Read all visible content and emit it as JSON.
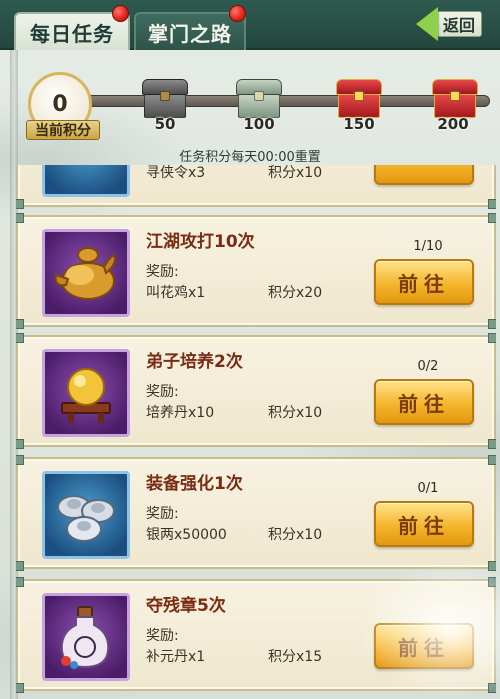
{
  "tabs": [
    {
      "label": "每日任务"
    },
    {
      "label": "掌门之路"
    }
  ],
  "back": {
    "label": "返回"
  },
  "progress": {
    "current_points": "0",
    "current_points_label": "当前积分",
    "milestones": [
      "50",
      "100",
      "150",
      "200"
    ],
    "reset_note": "任务积分每天00:00重置"
  },
  "tasks": [
    {
      "title": "江湖攻打10次",
      "reward_label": "奖励:",
      "reward_item": "叫花鸡x1",
      "reward_points": "积分x20",
      "progress": "1/10",
      "button": "前往",
      "icon": "roast-chicken-icon"
    },
    {
      "title": "弟子培养2次",
      "reward_label": "奖励:",
      "reward_item": "培养丹x10",
      "reward_points": "积分x10",
      "progress": "0/2",
      "button": "前往",
      "icon": "golden-orb-icon"
    },
    {
      "title": "装备强化1次",
      "reward_label": "奖励:",
      "reward_item": "银两x50000",
      "reward_points": "积分x10",
      "progress": "0/1",
      "button": "前往",
      "icon": "silver-ingots-icon"
    },
    {
      "title": "夺残章5次",
      "reward_label": "奖励:",
      "reward_item": "补元丹x1",
      "reward_points": "积分x15",
      "progress": "",
      "button": "前往",
      "icon": "potion-bottle-icon"
    }
  ],
  "partial_top_card": {
    "reward_points": "积分x10",
    "reward_item": "寻侠令x3"
  },
  "colors": {
    "header_bg": "#2f5a4f",
    "card_bg": "#f7f2e1",
    "title_color": "#7a2c14",
    "button_gold": "#f4b52c",
    "notification_red": "#e3271c"
  }
}
